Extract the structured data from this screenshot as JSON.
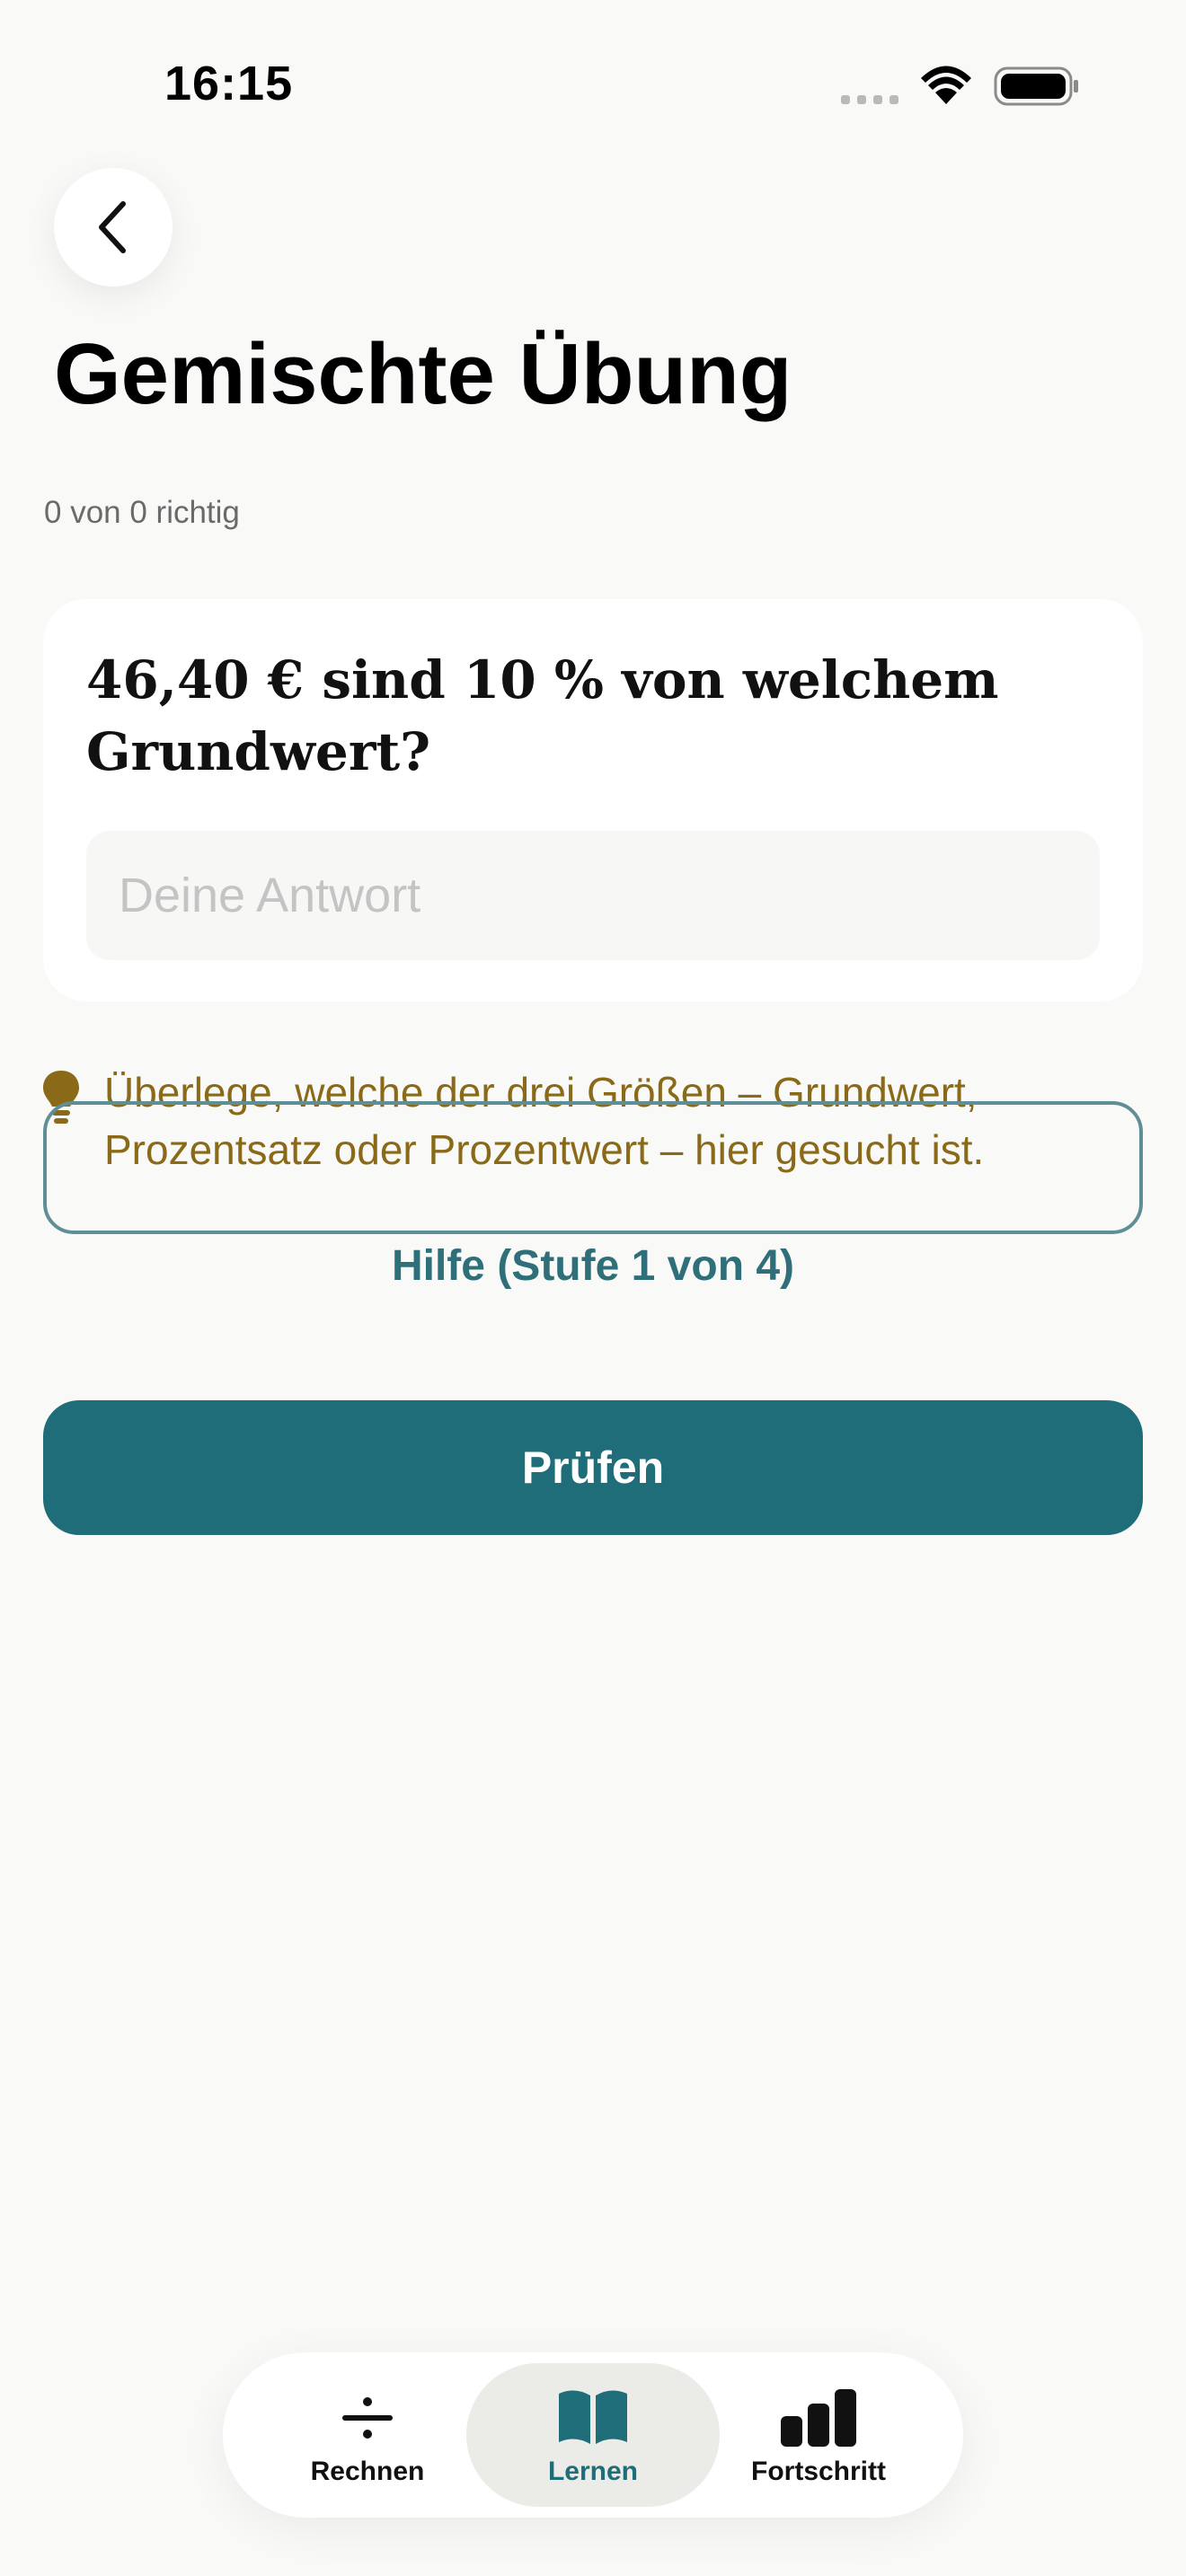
{
  "status_bar": {
    "time": "16:15"
  },
  "header": {
    "title": "Gemischte Übung",
    "progress": "0 von 0 richtig"
  },
  "question": {
    "text": "46,40 € sind 10 % von welchem Grundwert?",
    "answer_value": "",
    "answer_placeholder": "Deine Antwort"
  },
  "hint": {
    "icon": "lightbulb-icon",
    "text": "Überlege, welche der drei Größen – Grundwert, Prozentsatz oder Prozentwert – hier gesucht ist.",
    "color": "#8a6a18"
  },
  "help": {
    "label": "Hilfe (Stufe 1 von 4)"
  },
  "actions": {
    "check_label": "Prüfen",
    "accent_color": "#1e6d79"
  },
  "tabbar": {
    "tabs": [
      {
        "label": "Rechnen",
        "icon": "divide-icon",
        "active": false
      },
      {
        "label": "Lernen",
        "icon": "book-icon",
        "active": true
      },
      {
        "label": "Fortschritt",
        "icon": "bar-chart-icon",
        "active": false
      }
    ]
  }
}
